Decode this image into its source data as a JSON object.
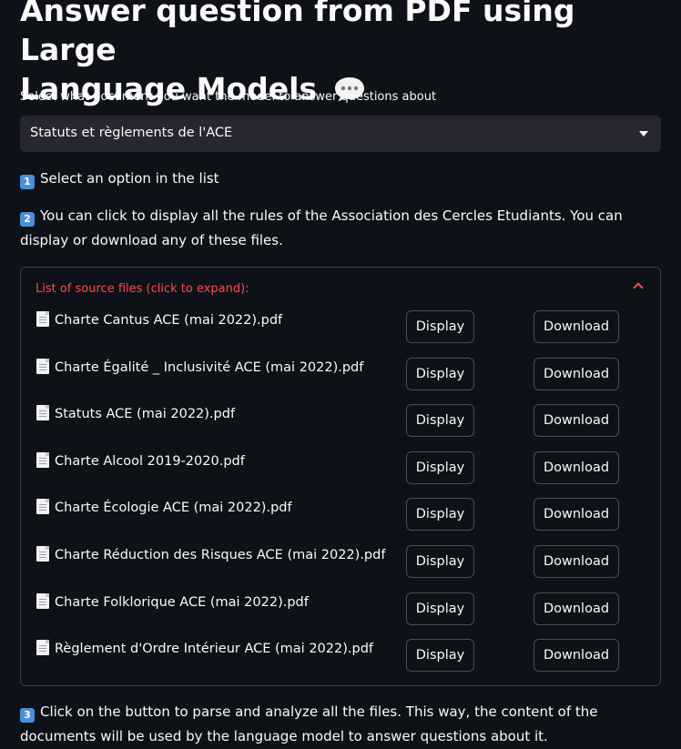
{
  "title": {
    "line1": "Answer question from PDF using Large",
    "line2": "Language Models",
    "icon": "speech-bubble-icon"
  },
  "select": {
    "label": "Select what document you want the model to answer questions about",
    "value": "Statuts et règlements de l'ACE"
  },
  "steps": {
    "step1": {
      "num": "1",
      "text": "Select an option in the list"
    },
    "step2": {
      "num": "2",
      "text": "You can click to display all the rules of the Association des Cercles Etudiants. You can display or download any of these files."
    },
    "step3": {
      "num": "3",
      "text": "Click on the button to parse and analyze all the files. This way, the content of the documents will be used by the language model to answer questions about it."
    }
  },
  "expander": {
    "header": "List of source files (click to expand):",
    "header_color": "#ff4b4b",
    "files": [
      {
        "name": "Charte Cantus ACE (mai 2022).pdf",
        "display": "Display",
        "download": "Download"
      },
      {
        "name": "Charte Égalité _ Inclusivité ACE (mai 2022).pdf",
        "display": "Display",
        "download": "Download"
      },
      {
        "name": "Statuts ACE (mai 2022).pdf",
        "display": "Display",
        "download": "Download"
      },
      {
        "name": "Charte Alcool 2019-2020.pdf",
        "display": "Display",
        "download": "Download"
      },
      {
        "name": "Charte Écologie ACE (mai 2022).pdf",
        "display": "Display",
        "download": "Download"
      },
      {
        "name": "Charte Réduction des Risques ACE (mai 2022).pdf",
        "display": "Display",
        "download": "Download"
      },
      {
        "name": "Charte Folklorique ACE (mai 2022).pdf",
        "display": "Display",
        "download": "Download"
      },
      {
        "name": "Règlement d'Ordre Intérieur ACE (mai 2022).pdf",
        "display": "Display",
        "download": "Download"
      }
    ]
  },
  "colors": {
    "background": "#0e1117",
    "select_bg": "#262730",
    "accent": "#ff4b4b",
    "keycap": "#4a8ed6"
  }
}
